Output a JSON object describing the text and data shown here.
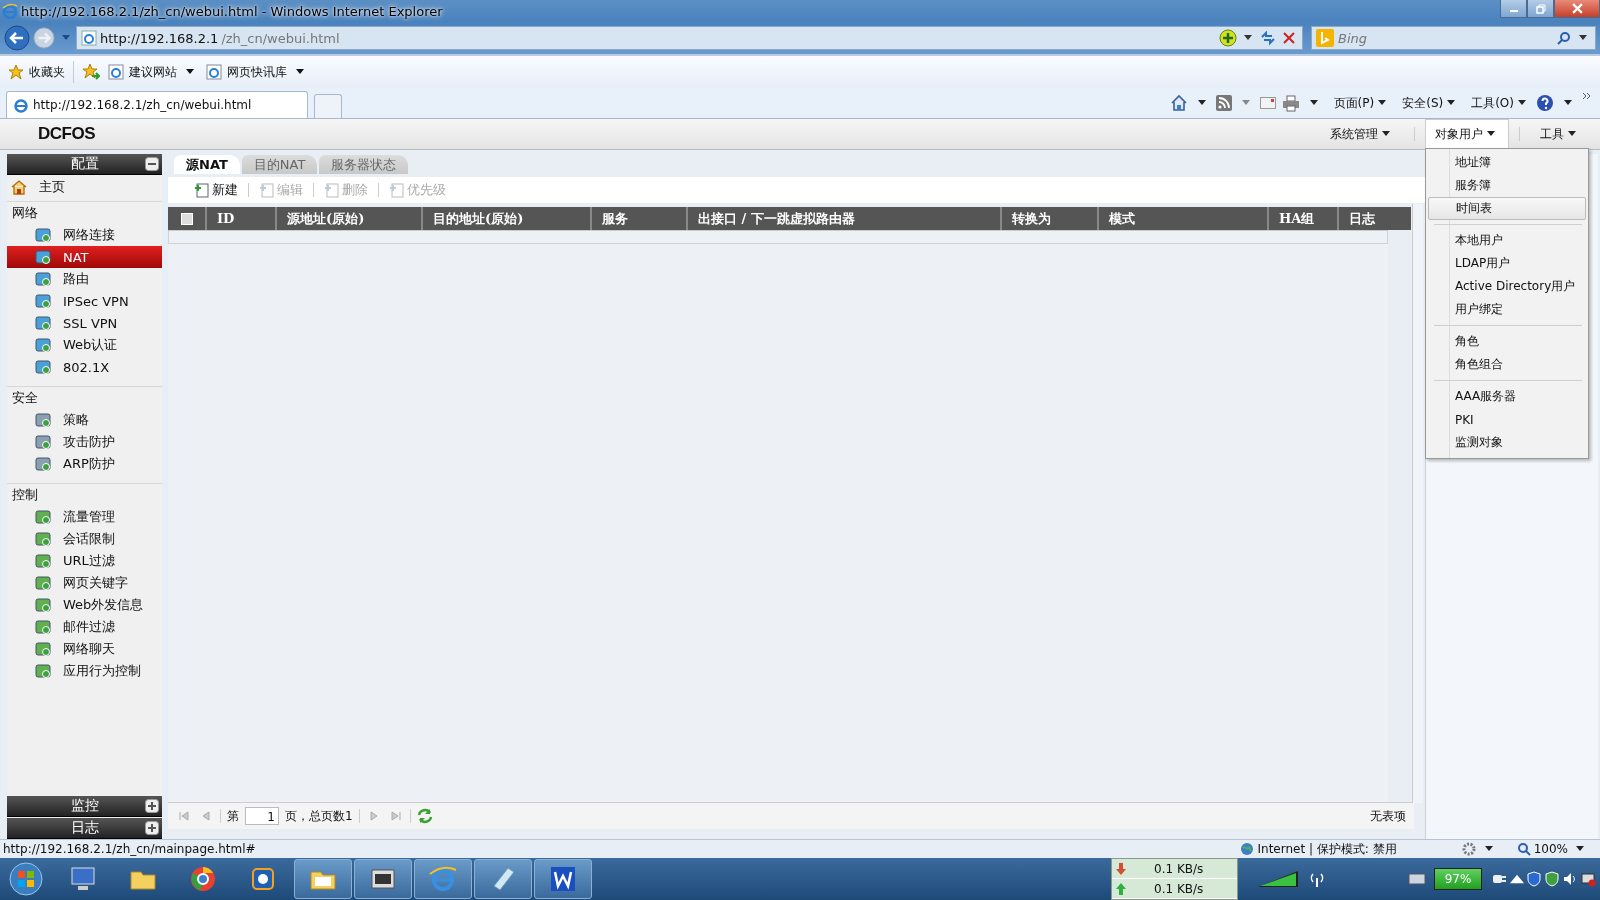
{
  "window": {
    "title": "http://192.168.2.1/zh_cn/webui.html - Windows Internet Explorer"
  },
  "address_bar": {
    "host": "http://192.168.2.1",
    "path": "/zh_cn/webui.html",
    "search_placeholder": "Bing"
  },
  "favorites_bar": {
    "label": "收藏夹",
    "links": [
      {
        "label": "建议网站"
      },
      {
        "label": "网页快讯库"
      }
    ]
  },
  "browser_tab": {
    "label": "http://192.168.2.1/zh_cn/webui.html"
  },
  "command_bar": [
    {
      "label": "页面(P)"
    },
    {
      "label": "安全(S)"
    },
    {
      "label": "工具(O)"
    }
  ],
  "app": {
    "logo": "DCFOS",
    "menus": [
      {
        "label": "系统管理",
        "open": false
      },
      {
        "label": "对象用户",
        "open": true
      },
      {
        "label": "工具",
        "open": false
      }
    ],
    "dropdown": [
      [
        {
          "label": "地址簿",
          "selected": false
        },
        {
          "label": "服务簿",
          "selected": false
        },
        {
          "label": "时间表",
          "selected": true
        }
      ],
      [
        {
          "label": "本地用户",
          "selected": false
        },
        {
          "label": "LDAP用户",
          "selected": false
        },
        {
          "label": "Active Directory用户",
          "selected": false
        },
        {
          "label": "用户绑定",
          "selected": false
        }
      ],
      [
        {
          "label": "角色",
          "selected": false
        },
        {
          "label": "角色组合",
          "selected": false
        }
      ],
      [
        {
          "label": "AAA服务器",
          "selected": false
        },
        {
          "label": "PKI",
          "selected": false
        },
        {
          "label": "监测对象",
          "selected": false
        }
      ]
    ]
  },
  "sidebar": {
    "heading": "配置",
    "home": "主页",
    "groups": [
      {
        "title": "网络",
        "items": [
          {
            "label": "网络连接",
            "selected": false
          },
          {
            "label": "NAT",
            "selected": true
          },
          {
            "label": "路由",
            "selected": false
          },
          {
            "label": "IPSec VPN",
            "selected": false
          },
          {
            "label": "SSL VPN",
            "selected": false
          },
          {
            "label": "Web认证",
            "selected": false
          },
          {
            "label": "802.1X",
            "selected": false
          }
        ]
      },
      {
        "title": "安全",
        "items": [
          {
            "label": "策略",
            "selected": false
          },
          {
            "label": "攻击防护",
            "selected": false
          },
          {
            "label": "ARP防护",
            "selected": false
          }
        ]
      },
      {
        "title": "控制",
        "items": [
          {
            "label": "流量管理",
            "selected": false
          },
          {
            "label": "会话限制",
            "selected": false
          },
          {
            "label": "URL过滤",
            "selected": false
          },
          {
            "label": "网页关键字",
            "selected": false
          },
          {
            "label": "Web外发信息",
            "selected": false
          },
          {
            "label": "邮件过滤",
            "selected": false
          },
          {
            "label": "网络聊天",
            "selected": false
          },
          {
            "label": "应用行为控制",
            "selected": false
          }
        ]
      }
    ],
    "panels": [
      {
        "label": "监控"
      },
      {
        "label": "日志"
      }
    ]
  },
  "tabs": [
    {
      "label": "源NAT",
      "selected": true
    },
    {
      "label": "目的NAT",
      "selected": false
    },
    {
      "label": "服务器状态",
      "selected": false
    }
  ],
  "toolbar": [
    {
      "label": "新建",
      "disabled": false
    },
    {
      "label": "编辑",
      "disabled": true
    },
    {
      "label": "删除",
      "disabled": true
    },
    {
      "label": "优先级",
      "disabled": true
    }
  ],
  "table": {
    "select_all_checked": false,
    "columns": [
      "ID",
      "源地址(原始)",
      "目的地址(原始)",
      "服务",
      "出接口 / 下一跳虚拟路由器",
      "转换为",
      "模式",
      "HA组",
      "日志"
    ]
  },
  "pagination": {
    "prefix": "第",
    "page": "1",
    "suffix": "页，总页数1",
    "empty_text": "无表项"
  },
  "status_bar": {
    "url": "http://192.168.2.1/zh_cn/mainpage.html#",
    "zone": "Internet | 保护模式: 禁用",
    "zoom": "100%"
  },
  "taskbar": {
    "download": "0.1 KB/s",
    "upload": "0.1 KB/s",
    "battery": "97%"
  }
}
